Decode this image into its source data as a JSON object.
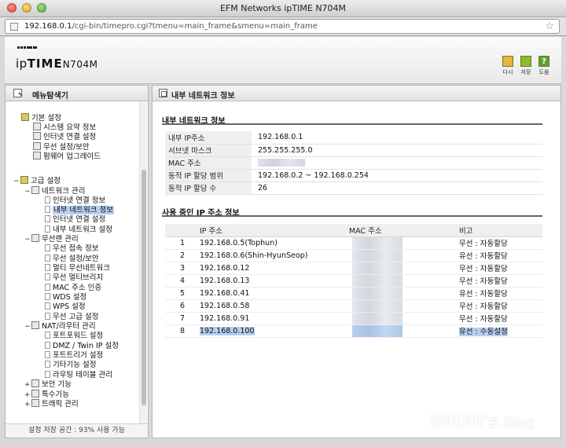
{
  "window": {
    "title": "EFM Networks ipTIME N704M"
  },
  "address_bar": {
    "host": "192.168.0.1",
    "path": "/cgi-bin/timepro.cgi?tmenu=main_frame&smenu=main_frame"
  },
  "header": {
    "brand_ip": "ip",
    "brand_time": "TIME",
    "brand_model": "N704M",
    "buttons": {
      "back": "다시",
      "save": "저장",
      "help": "도움",
      "help_glyph": "?"
    }
  },
  "nav": {
    "title": "메뉴탐색기",
    "items": {
      "basic": "기본 설정",
      "system_summary": "시스템 요약 정보",
      "internet_setup": "인터넷 연결 설정",
      "wireless_setup": "무선 설정/보안",
      "firmware": "펌웨어 업그레이드",
      "advanced": "고급 설정",
      "network_mgmt": "네트워크 관리",
      "internet_info": "인터넷 연결 정보",
      "lan_info": "내부 네트워크 정보",
      "internet_setup2": "인터넷 연결 설정",
      "lan_setup": "내부 네트워크 설정",
      "wireless_mgmt": "무선랜 관리",
      "wireless_status": "무선 접속 정보",
      "wireless_setup2": "무선 설정/보안",
      "multi_ssid": "멀티 무선네트워크",
      "wds_bridge": "무선 멀티브리지",
      "mac_auth": "MAC 주소 인증",
      "wds": "WDS 설정",
      "wps": "WPS 설정",
      "wireless_adv": "무선 고급 설정",
      "nat_router": "NAT/라우터 관리",
      "port_forward": "포트포워드 설정",
      "dmz": "DMZ / Twin IP 설정",
      "port_trigger": "포트트리거 설정",
      "misc": "기타기능 설정",
      "routing": "라우팅 테이블 관리",
      "security": "보안 기능",
      "special": "특수기능",
      "traffic": "트래픽 관리"
    },
    "footer": "설정 저장 공간 : 93% 사용 가능"
  },
  "main": {
    "title": "내부 네트워크 정보",
    "section1": "내부 네트워크 정보",
    "info": [
      {
        "key": "내부 IP주소",
        "value": "192.168.0.1"
      },
      {
        "key": "서브넷 마스크",
        "value": "255.255.255.0"
      },
      {
        "key": "MAC 주소",
        "value": ""
      },
      {
        "key": "동적 IP 할당 범위",
        "value": "192.168.0.2 ~  192.168.0.254"
      },
      {
        "key": "동적 IP 할당 수",
        "value": "26"
      }
    ],
    "section2": "사용 중인 IP 주소 정보",
    "ip_table": {
      "headers": {
        "ip": "IP 주소",
        "mac": "MAC 주소",
        "note": "비고"
      },
      "rows": [
        {
          "no": "1",
          "ip": "192.168.0.5(Tophun)",
          "note": "무선 : 자동할당"
        },
        {
          "no": "2",
          "ip": "192.168.0.6(Shin-HyunSeop)",
          "note": "유선 : 자동할당"
        },
        {
          "no": "3",
          "ip": "192.168.0.12",
          "note": "무선 : 자동할당"
        },
        {
          "no": "4",
          "ip": "192.168.0.13",
          "note": "무선 : 자동할당"
        },
        {
          "no": "5",
          "ip": "192.168.0.41",
          "note": "유선 : 자동할당"
        },
        {
          "no": "6",
          "ip": "192.168.0.58",
          "note": "무선 : 자동할당"
        },
        {
          "no": "7",
          "ip": "192.168.0.91",
          "note": "무선 : 자동할당"
        },
        {
          "no": "8",
          "ip": "192.168.0.100",
          "note": "유선 : 수동설정"
        }
      ]
    }
  },
  "watermark": {
    "a": "iMON's",
    "b": " Blog"
  }
}
